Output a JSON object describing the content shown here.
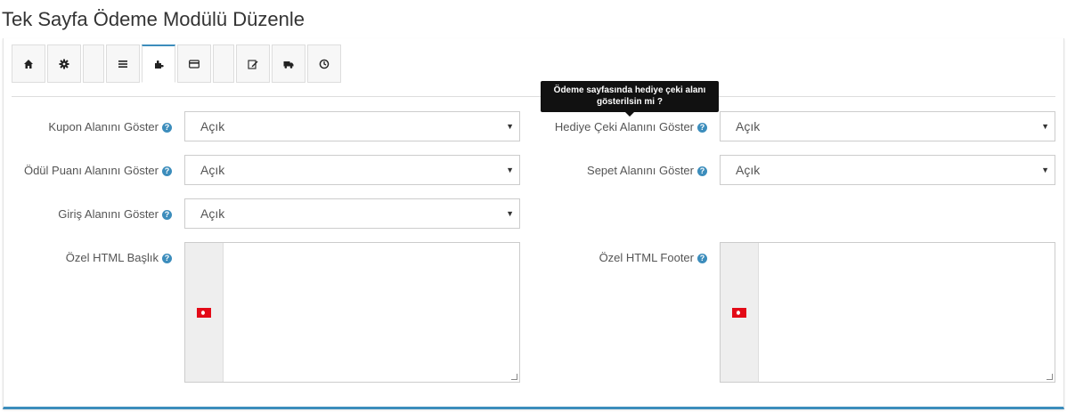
{
  "page": {
    "title": "Tek Sayfa Ödeme Modülü Düzenle"
  },
  "tabs": [
    {
      "icon": "home-icon"
    },
    {
      "icon": "gear-icon"
    },
    {
      "icon": "blank"
    },
    {
      "icon": "list-icon"
    },
    {
      "icon": "puzzle-icon",
      "active": true
    },
    {
      "icon": "credit-card-icon"
    },
    {
      "icon": "blank"
    },
    {
      "icon": "edit-icon"
    },
    {
      "icon": "truck-icon"
    },
    {
      "icon": "clock-icon"
    }
  ],
  "tooltip": {
    "text_line1": "Ödeme sayfasında hediye çeki alanı",
    "text_line2": "gösterilsin mi ?"
  },
  "fields": {
    "coupon": {
      "label": "Kupon Alanını Göster",
      "value": "Açık"
    },
    "gift": {
      "label": "Hediye Çeki Alanını Göster",
      "value": "Açık"
    },
    "reward": {
      "label": "Ödül Puanı Alanını Göster",
      "value": "Açık"
    },
    "cart": {
      "label": "Sepet Alanını Göster",
      "value": "Açık"
    },
    "login": {
      "label": "Giriş Alanını Göster",
      "value": "Açık"
    },
    "header_html": {
      "label": "Özel HTML Başlık"
    },
    "footer_html": {
      "label": "Özel HTML Footer"
    }
  },
  "help_glyph": "?",
  "caret_glyph": "▼",
  "colors": {
    "accent": "#3c8dbc",
    "flag": "#e30a17"
  }
}
